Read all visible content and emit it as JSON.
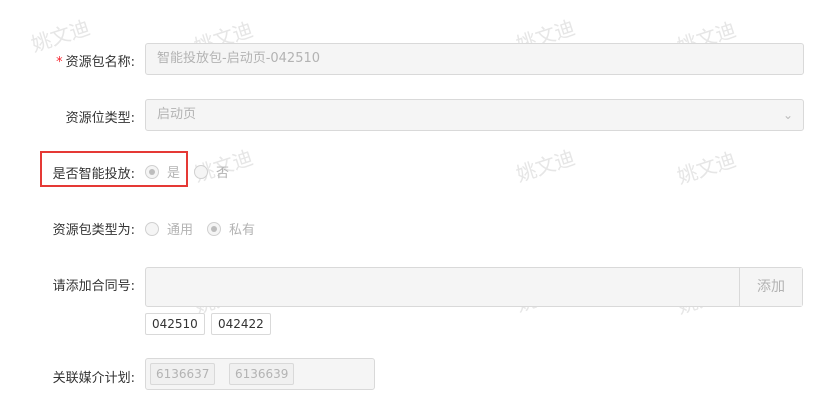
{
  "watermark": "姚文迪",
  "form": {
    "package_name": {
      "required_mark": "*",
      "label": "资源包名称:",
      "value": "智能投放包-启动页-042510"
    },
    "slot_type": {
      "label": "资源位类型:",
      "value": "启动页"
    },
    "smart_delivery": {
      "label": "是否智能投放:",
      "options": [
        "是",
        "否"
      ],
      "selected": "是"
    },
    "package_type": {
      "label": "资源包类型为:",
      "options": [
        "通用",
        "私有"
      ],
      "selected": "私有"
    },
    "contract": {
      "label": "请添加合同号:",
      "add_button": "添加",
      "tags": [
        "042510",
        "042422"
      ]
    },
    "media_plan": {
      "label": "关联媒介计划:",
      "tags": [
        "6136637",
        "6136639"
      ]
    }
  },
  "colors": {
    "highlight_border": "#e53935",
    "required": "#f5222d"
  }
}
